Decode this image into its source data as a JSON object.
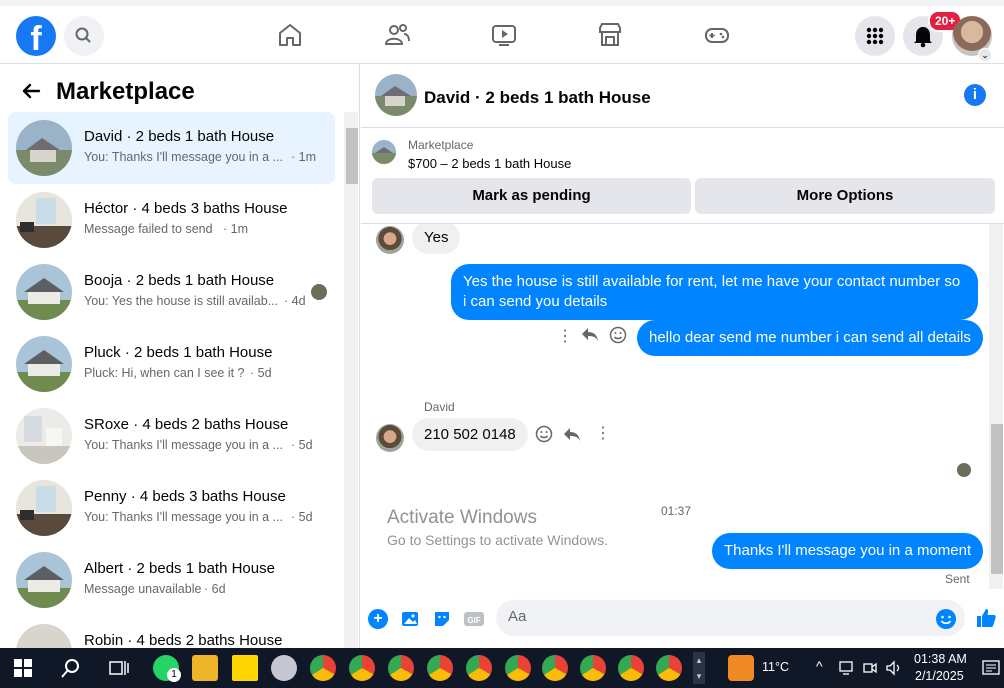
{
  "top_nav": {
    "logo": "f",
    "notification_badge": "20+",
    "icons": [
      "search-icon",
      "home-icon",
      "friends-icon",
      "watch-icon",
      "marketplace-icon",
      "gaming-icon",
      "menu-grid-icon",
      "bell-icon"
    ]
  },
  "sidebar": {
    "title": "Marketplace",
    "conversations": [
      {
        "title": "David · 2 beds 1 bath House",
        "preview": "You: Thanks I'll message you in a ...",
        "time": "· 1m",
        "active": true
      },
      {
        "title": "Héctor · 4 beds 3 baths House",
        "preview": "Message failed to send",
        "time": "· 1m"
      },
      {
        "title": "Booja · 2 beds 1 bath House",
        "preview": "You: Yes the house is still availab...",
        "time": "· 4d"
      },
      {
        "title": "Pluck · 2 beds 1 bath House",
        "preview": "Pluck: Hi, when can I see it ?",
        "time": "· 5d"
      },
      {
        "title": "SRoxe · 4 beds 2 baths House",
        "preview": "You: Thanks I'll message you in a ...",
        "time": "· 5d"
      },
      {
        "title": "Penny · 4 beds 3 baths House",
        "preview": "You: Thanks I'll message you in a ...",
        "time": "· 5d"
      },
      {
        "title": "Albert · 2 beds 1 bath House",
        "preview": "Message unavailable",
        "time": "· 6d"
      },
      {
        "title": "Robin · 4 beds 2 baths House",
        "preview": "",
        "time": ""
      }
    ]
  },
  "chat": {
    "title": "David · 2 beds 1 bath House",
    "listing_category": "Marketplace",
    "listing_price": "$700 – 2 beds 1 bath House",
    "mark_pending_label": "Mark as pending",
    "more_options_label": "More Options",
    "messages": {
      "in_1": "Yes",
      "out_1": "Yes the house is still available for rent, let me have your contact number so i can send you details",
      "out_2": "hello dear send me number i can send all details",
      "sender_name": "David",
      "in_2": "210 502 0148",
      "timestamp": "01:37",
      "out_3": "Thanks I'll message you in a moment",
      "status": "Sent"
    },
    "composer_placeholder": "Aa"
  },
  "watermark": {
    "line1": "Activate Windows",
    "line2": "Go to Settings to activate Windows."
  },
  "taskbar": {
    "weather": "11°C",
    "time": "01:38 AM",
    "date": "2/1/2025",
    "notification_count": "1"
  }
}
